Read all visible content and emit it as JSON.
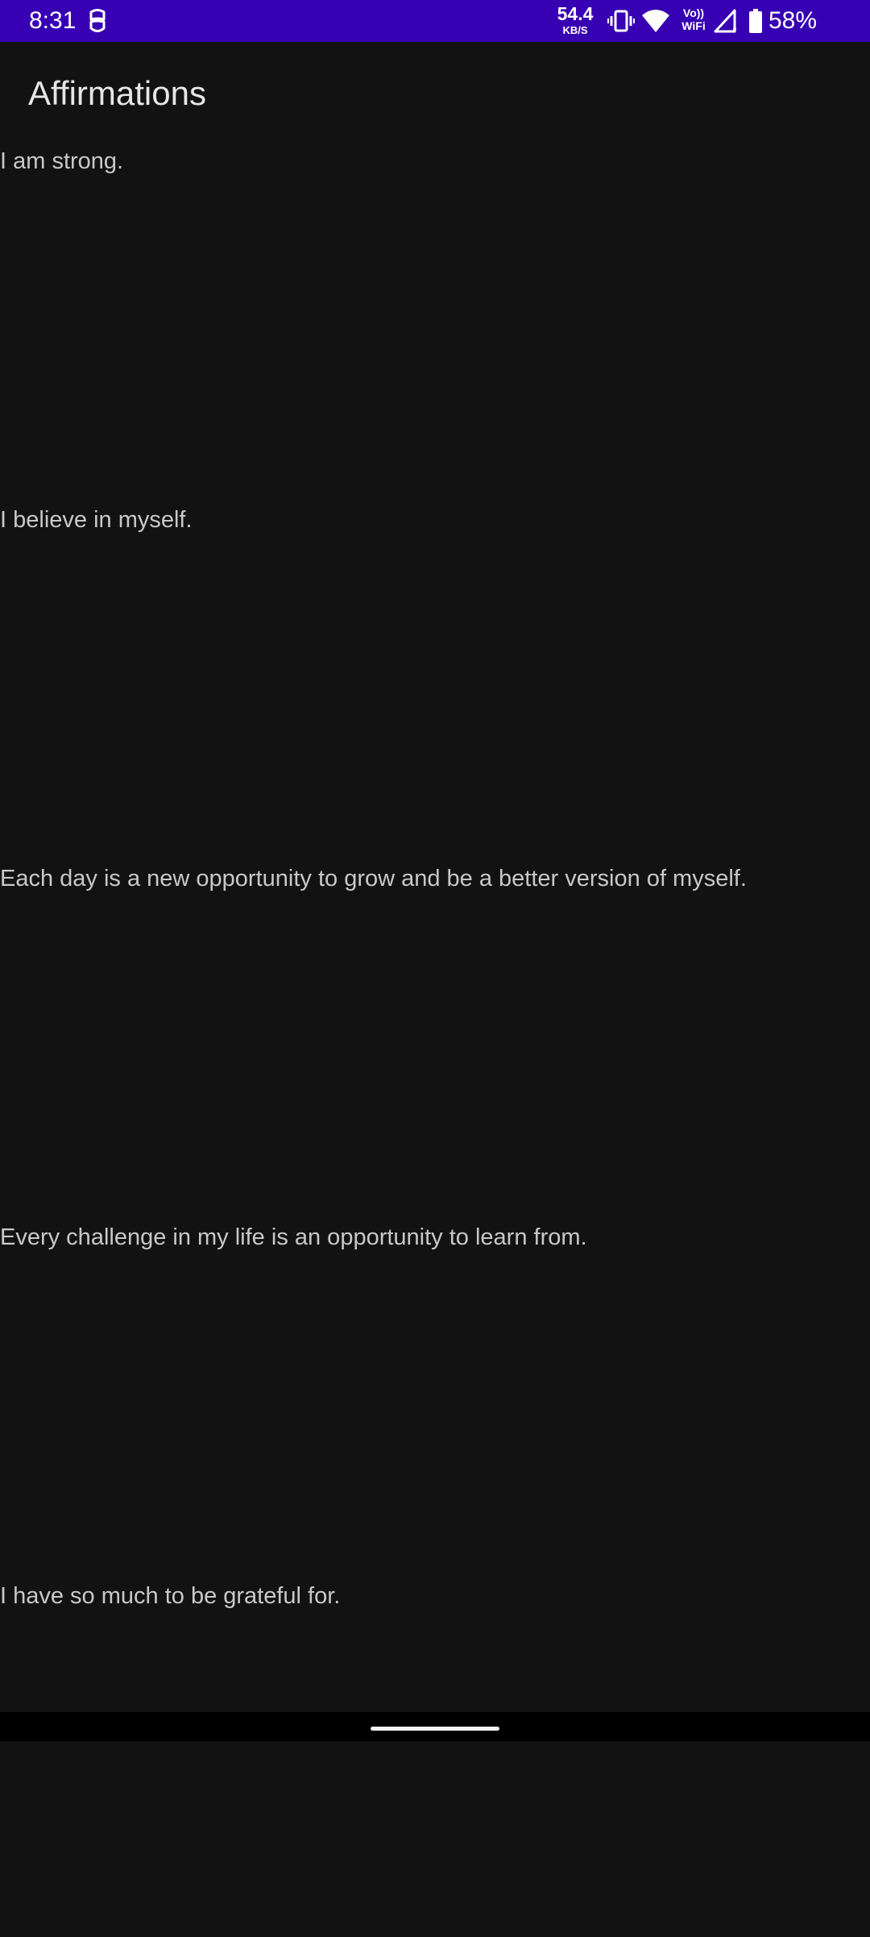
{
  "status_bar": {
    "time": "8:31",
    "net_speed_value": "54.4",
    "net_speed_unit": "KB/S",
    "vowifi_top": "Vo))",
    "vowifi_bottom": "WiFi",
    "battery_percent": "58%",
    "background_color": "#3700b3",
    "icons": [
      "notification-icon",
      "vibrate-icon",
      "wifi-icon",
      "cell-signal-icon",
      "battery-icon"
    ]
  },
  "app_bar": {
    "title": "Affirmations"
  },
  "affirmations": [
    "I am strong.",
    "I believe in myself.",
    "Each day is a new opportunity to grow and be a better version of myself.",
    "Every challenge in my life is an opportunity to learn from.",
    "I have so much to be grateful for."
  ],
  "theme": {
    "background": "#121212",
    "text": "#c8c8c8"
  }
}
